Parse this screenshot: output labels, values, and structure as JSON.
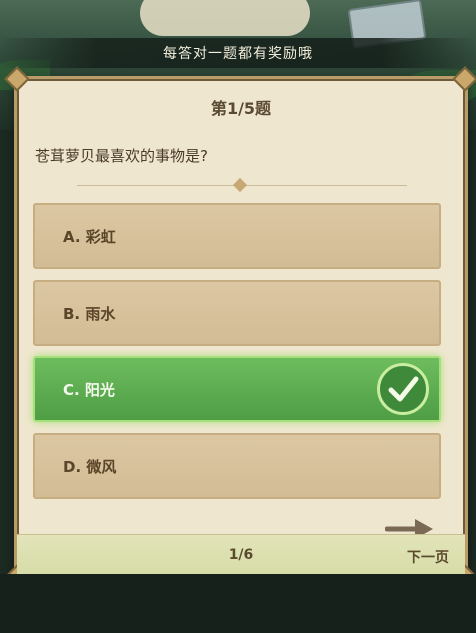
{
  "banner": {
    "text": "每答对一题都有奖励哦"
  },
  "quiz": {
    "question_number": "第1/5题",
    "question": "苍茸萝贝最喜欢的事物是?",
    "options": [
      {
        "label": "A. 彩虹",
        "correct": false
      },
      {
        "label": "B. 雨水",
        "correct": false
      },
      {
        "label": "C. 阳光",
        "correct": true
      },
      {
        "label": "D. 微风",
        "correct": false
      }
    ],
    "page_indicator": "1/6",
    "next_label": "下一页"
  },
  "icons": {
    "check": "checkmark-icon",
    "next_arrow": "arrow-right-icon"
  },
  "colors": {
    "card_bg": "#efe6cf",
    "option_bg": "#d6c09b",
    "correct_bg": "#5cab4f",
    "text": "#5a4528"
  }
}
